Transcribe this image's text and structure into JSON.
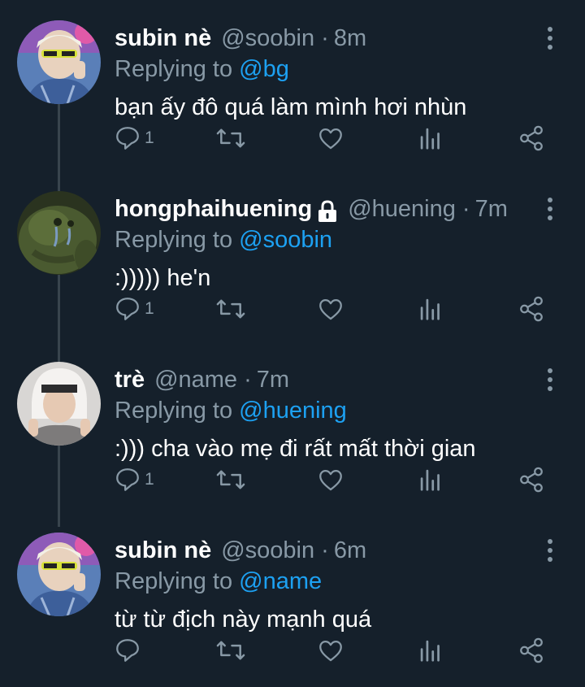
{
  "tweets": [
    {
      "display_name": "subin nè",
      "handle": "@soobin",
      "separator": "·",
      "time": "8m",
      "replying_prefix": "Replying to",
      "replying_to": "@bg",
      "text": "bạn ấy đô quá làm mình hơi nhùn",
      "reply_count": "1",
      "locked": false,
      "avatar": "avatar-blonde-sunglasses"
    },
    {
      "display_name": "hongphaihuening",
      "handle": "@huening",
      "separator": "·",
      "time": "7m",
      "replying_prefix": "Replying to",
      "replying_to": "@soobin",
      "text": ":))))) he'n",
      "reply_count": "1",
      "locked": true,
      "avatar": "avatar-green-frog"
    },
    {
      "display_name": "trè",
      "handle": "@name",
      "separator": "·",
      "time": "7m",
      "replying_prefix": "Replying to",
      "replying_to": "@huening",
      "text": ":))) cha vào mẹ đi rất mất thời gian",
      "reply_count": "1",
      "locked": false,
      "avatar": "avatar-white-hat"
    },
    {
      "display_name": "subin nè",
      "handle": "@soobin",
      "separator": "·",
      "time": "6m",
      "replying_prefix": "Replying to",
      "replying_to": "@name",
      "text": "từ từ địch này mạnh quá",
      "reply_count": "",
      "locked": false,
      "avatar": "avatar-blonde-sunglasses"
    }
  ],
  "icons": [
    "reply-icon",
    "retweet-icon",
    "like-icon",
    "analytics-icon",
    "share-icon",
    "more-icon",
    "lock-icon"
  ],
  "colors": {
    "background": "#15202b",
    "text": "#ffffff",
    "muted": "#8899a6",
    "link": "#1da1f2",
    "thread_line": "#38444d"
  }
}
